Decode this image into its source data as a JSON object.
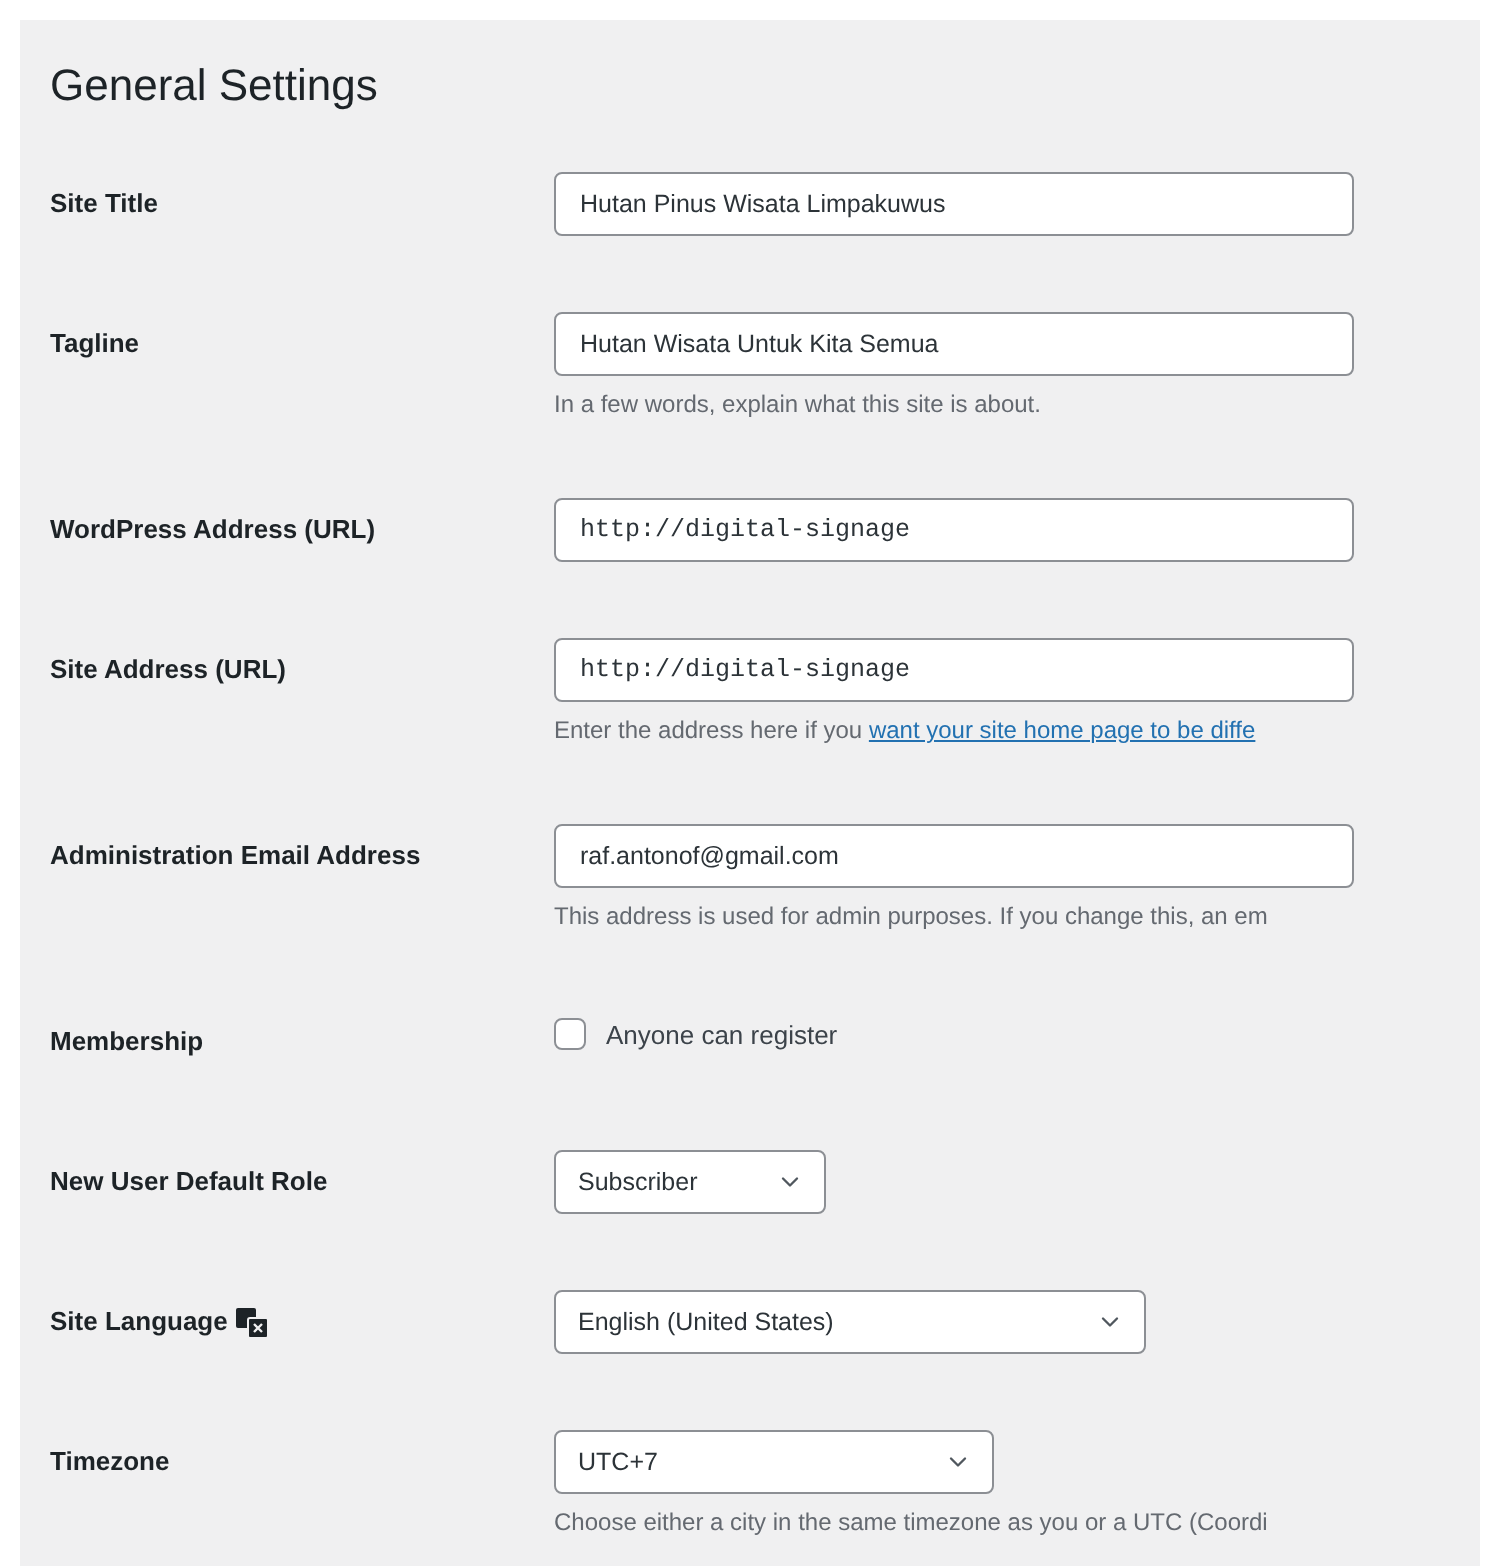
{
  "page": {
    "title": "General Settings"
  },
  "fields": [
    {
      "kind": "text",
      "label": "Site Title",
      "value": "Hutan Pinus Wisata Limpakuwus",
      "mono": false
    },
    {
      "kind": "text",
      "label": "Tagline",
      "value": "Hutan Wisata Untuk Kita Semua",
      "mono": false,
      "description": "In a few words, explain what this site is about."
    },
    {
      "kind": "text",
      "label": "WordPress Address (URL)",
      "value": "http://digital-signage",
      "mono": true
    },
    {
      "kind": "text",
      "label": "Site Address (URL)",
      "value": "http://digital-signage",
      "mono": true,
      "description": "Enter the address here if you ",
      "link": "want your site home page to be diffe"
    },
    {
      "kind": "text",
      "label": "Administration Email Address",
      "value": "raf.antonof@gmail.com",
      "mono": false,
      "description": "This address is used for admin purposes. If you change this, an em"
    },
    {
      "kind": "checkbox",
      "label": "Membership",
      "option": "Anyone can register",
      "checked": false
    },
    {
      "kind": "select",
      "label": "New User Default Role",
      "value": "Subscriber"
    },
    {
      "kind": "select",
      "label": "Site Language",
      "value": "English (United States)",
      "language_icon": true
    },
    {
      "kind": "select",
      "label": "Timezone",
      "value": "UTC+7",
      "description": "Choose either a city in the same timezone as you or a UTC (Coordi"
    }
  ]
}
